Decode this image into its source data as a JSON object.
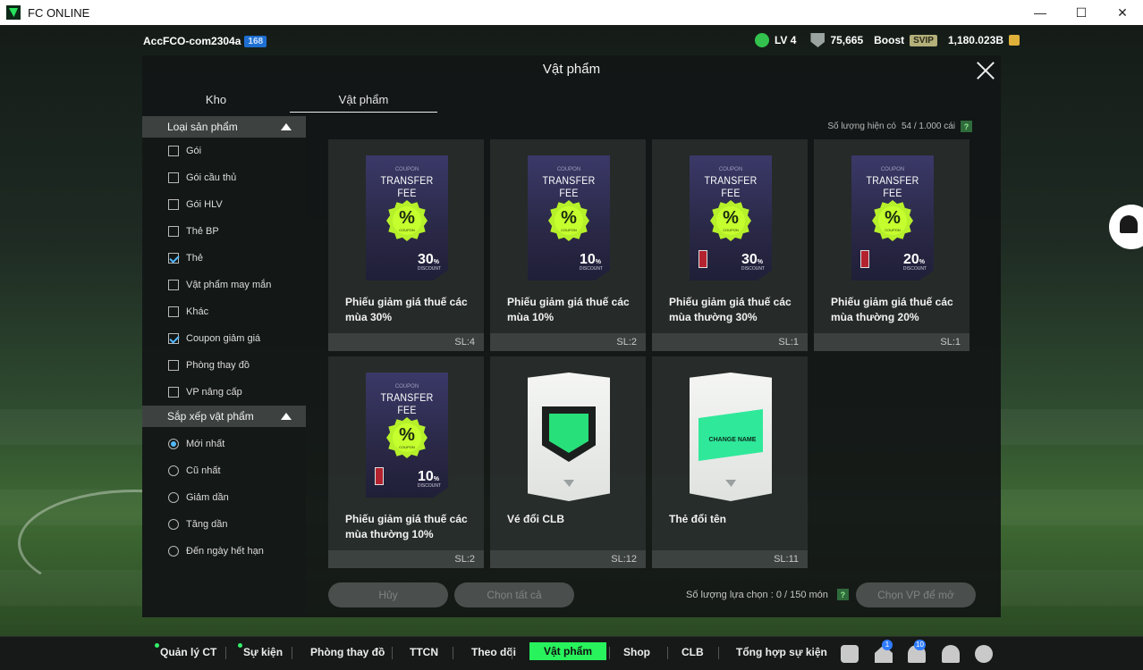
{
  "window": {
    "title": "FC ONLINE",
    "minimize": "—",
    "maximize": "☐",
    "close": "✕"
  },
  "topbar": {
    "account": "AccFCO-com2304a",
    "account_badge": "168",
    "level": "LV 4",
    "points": "75,665",
    "boost": "Boost",
    "svip": "SVIP",
    "balance": "1,180.023B"
  },
  "panel": {
    "title": "Vật phẩm",
    "tabs": [
      "Kho",
      "Vật phẩm"
    ],
    "capacity_label": "Số lượng hiện có",
    "capacity_value": "54 / 1.000 cái",
    "help": "?"
  },
  "sidebar": {
    "filter_title": "Loại sản phẩm",
    "filters": [
      {
        "label": "Gói",
        "checked": false
      },
      {
        "label": "Gói cầu thủ",
        "checked": false
      },
      {
        "label": "Gói HLV",
        "checked": false
      },
      {
        "label": "Thẻ BP",
        "checked": false
      },
      {
        "label": "Thẻ",
        "checked": true
      },
      {
        "label": "Vật phẩm may mắn",
        "checked": false
      },
      {
        "label": "Khác",
        "checked": false
      },
      {
        "label": "Coupon giảm giá",
        "checked": true
      },
      {
        "label": "Phòng thay đồ",
        "checked": false
      },
      {
        "label": "VP nâng cấp",
        "checked": false
      }
    ],
    "sort_title": "Sắp xếp vật phẩm",
    "sorts": [
      {
        "label": "Mới nhất",
        "selected": true
      },
      {
        "label": "Cũ nhất",
        "selected": false
      },
      {
        "label": "Giảm dần",
        "selected": false
      },
      {
        "label": "Tăng dần",
        "selected": false
      },
      {
        "label": "Đến ngày hết hạn",
        "selected": false
      }
    ]
  },
  "items": [
    {
      "kind": "coupon",
      "name": "Phiếu giảm giá thuế các mùa 30%",
      "qty": "SL:4",
      "coupon_small": "COUPON",
      "coupon_title": "TRANSFER FEE",
      "pct_sub": "COUPON",
      "discount": "30",
      "discount_unit": "%",
      "discount_label": "DISCOUNT",
      "flag": false
    },
    {
      "kind": "coupon",
      "name": "Phiếu giảm giá thuế các mùa 10%",
      "qty": "SL:2",
      "coupon_small": "COUPON",
      "coupon_title": "TRANSFER FEE",
      "pct_sub": "COUPON",
      "discount": "10",
      "discount_unit": "%",
      "discount_label": "DISCOUNT",
      "flag": false
    },
    {
      "kind": "coupon",
      "name": "Phiếu giảm giá thuế các mùa thường 30%",
      "qty": "SL:1",
      "coupon_small": "COUPON",
      "coupon_title": "TRANSFER FEE",
      "pct_sub": "COUPON",
      "discount": "30",
      "discount_unit": "%",
      "discount_label": "DISCOUNT",
      "flag": true
    },
    {
      "kind": "coupon",
      "name": "Phiếu giảm giá thuế các mùa thường 20%",
      "qty": "SL:1",
      "coupon_small": "COUPON",
      "coupon_title": "TRANSFER FEE",
      "pct_sub": "COUPON",
      "discount": "20",
      "discount_unit": "%",
      "discount_label": "DISCOUNT",
      "flag": true
    },
    {
      "kind": "coupon",
      "name": "Phiếu giảm giá thuế các mùa thường 10%",
      "qty": "SL:2",
      "coupon_small": "COUPON",
      "coupon_title": "TRANSFER FEE",
      "pct_sub": "COUPON",
      "discount": "10",
      "discount_unit": "%",
      "discount_label": "DISCOUNT",
      "flag": true
    },
    {
      "kind": "clb",
      "name": "Vé đổi CLB",
      "qty": "SL:12"
    },
    {
      "kind": "rename",
      "name": "Thẻ đổi tên",
      "qty": "SL:11",
      "art_text": "CHANGE NAME"
    }
  ],
  "footer": {
    "cancel": "Hủy",
    "select_all": "Chọn tất cả",
    "selected_label": "Số lượng lựa chọn : 0 / 150 món",
    "help": "?",
    "open": "Chọn VP để mở"
  },
  "nav": {
    "items": [
      "Quản lý CT",
      "Sự kiện",
      "Phòng thay đồ",
      "TTCN",
      "Theo dõi",
      "Vật phẩm",
      "Shop",
      "CLB",
      "Tổng hợp sự kiện"
    ],
    "active": "Vật phẩm",
    "home_badge": "1",
    "bell_badge": "10"
  },
  "colors": {
    "accent": "#28f25c",
    "check": "#55b8ff"
  }
}
